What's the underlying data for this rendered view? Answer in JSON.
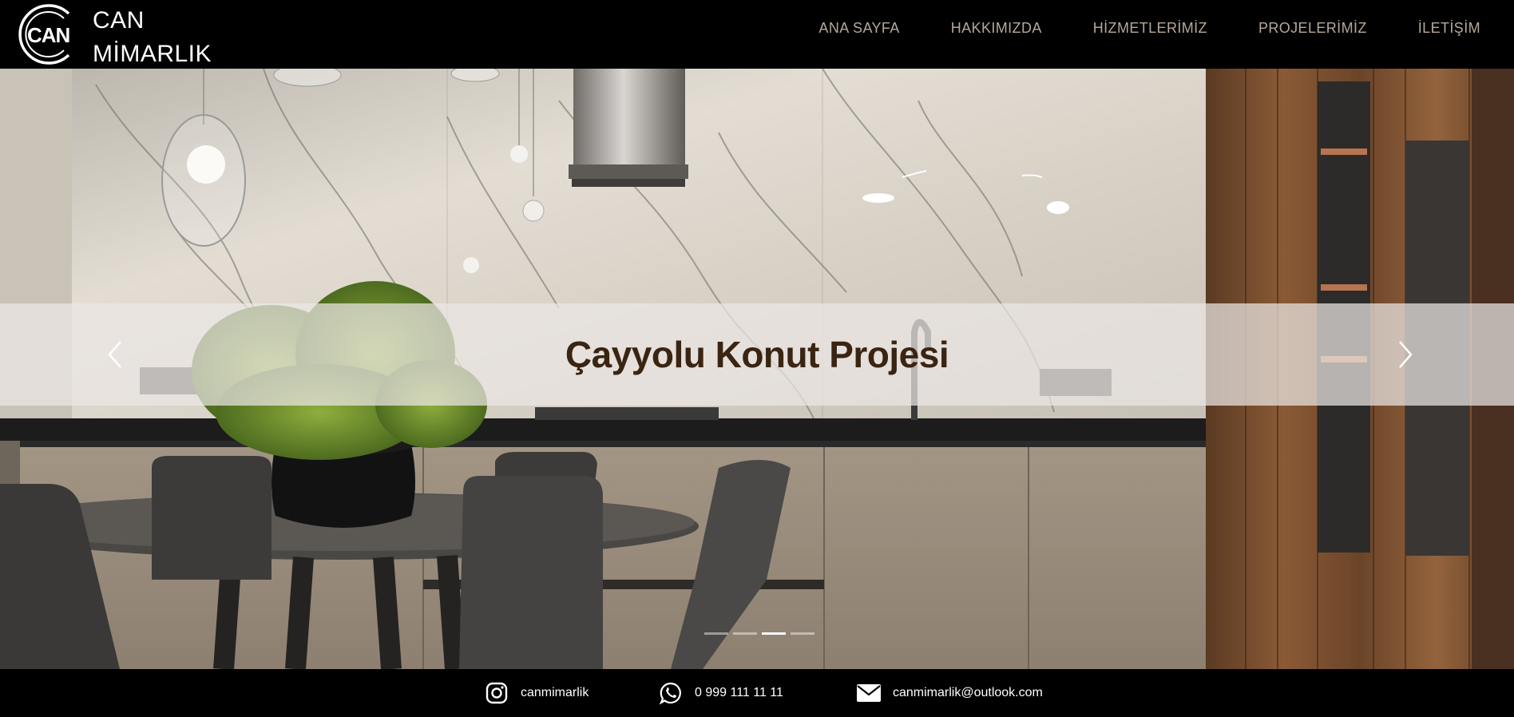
{
  "brand": {
    "logo_text": "CAN",
    "name_line1": "CAN",
    "name_line2": "MİMARLIK"
  },
  "nav": {
    "items": [
      {
        "label": "ANA SAYFA"
      },
      {
        "label": "HAKKIMIZDA"
      },
      {
        "label": "HİZMETLERİMİZ"
      },
      {
        "label": "PROJELERİMİZ"
      },
      {
        "label": "İLETİŞİM"
      }
    ]
  },
  "hero": {
    "caption": "Çayyolu Konut Projesi",
    "prev_icon": "chevron-left-icon",
    "next_icon": "chevron-right-icon",
    "slide_count": 4,
    "active_slide": 3
  },
  "footer": {
    "instagram": {
      "icon": "instagram-icon",
      "label": "canmimarlik"
    },
    "whatsapp": {
      "icon": "whatsapp-icon",
      "label": "0 999 111 11 11"
    },
    "email": {
      "icon": "envelope-icon",
      "label": "canmimarlik@outlook.com"
    }
  },
  "colors": {
    "header_bg": "#000000",
    "nav_text": "#b6a89a",
    "caption_text": "#3a2412",
    "footer_text": "#ffffff"
  }
}
